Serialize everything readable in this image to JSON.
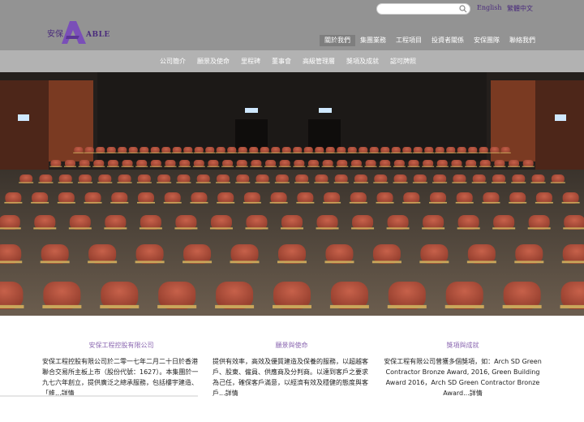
{
  "header": {
    "search_placeholder": "",
    "lang_en": "English",
    "lang_zh": "繁體中文",
    "logo_cn": "安保",
    "logo_text": "ABLE",
    "nav": [
      "關於我們",
      "集團業務",
      "工程項目",
      "投資者關係",
      "安保團隊",
      "聯絡我們"
    ],
    "active_nav": 0
  },
  "subnav": [
    "公司簡介",
    "願景及使命",
    "里程碑",
    "董事會",
    "高級管理層",
    "獎項及成就",
    "認可牌照"
  ],
  "carousel": {
    "count": 7,
    "active": 0
  },
  "columns": [
    {
      "title": "安保工程控股有限公司",
      "text": "安保工程控股有限公司於二零一七年二月二十日於香港聯合交易所主板上市（股份代號：1627）。本集團於一九七六年創立，提供廣泛之總承服務，包括樓宇建造、「維...",
      "more": "詳情"
    },
    {
      "title": "願景與使命",
      "text": "提供有效率，高效及優質建造及保養的服務，以超越客戶、股東、僱員、供應商及分判商。以達到客戶之要求為己任，確保客戶滿意，以經濟有效及穩健的態度與客戶...",
      "more": "詳情"
    },
    {
      "title": "獎項與成就",
      "text": "安保工程有限公司曾獲多個獎項，如：Arch SD Green Contractor Bronze Award, 2016, Green Building Award 2016，Arch SD Green Contractor Bronze Award...",
      "more": "詳情"
    }
  ],
  "colors": {
    "header": "#939393",
    "subnav": "#b2b2b2",
    "brand": "#4a2b7c",
    "accent": "#8a66b0"
  }
}
